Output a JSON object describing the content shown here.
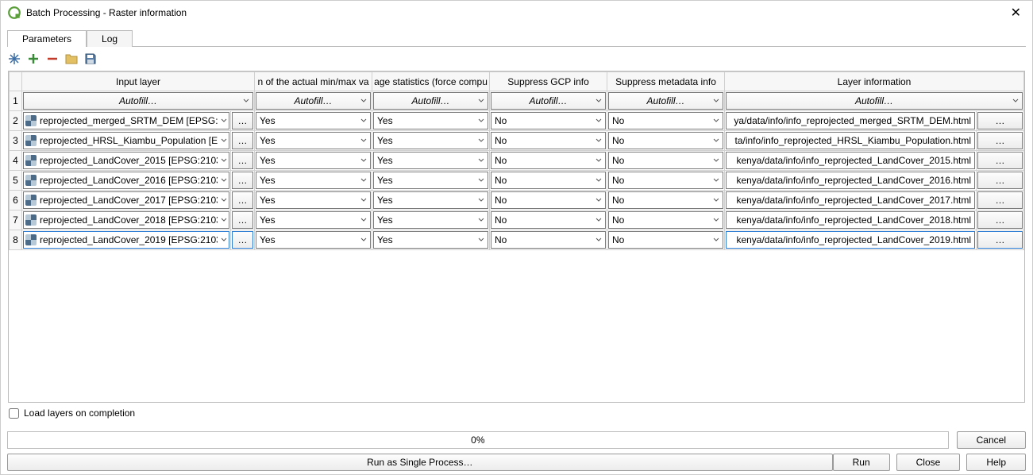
{
  "window": {
    "title": "Batch Processing - Raster information"
  },
  "tabs": {
    "parameters": "Parameters",
    "log": "Log"
  },
  "headers": {
    "input": "Input layer",
    "minmax": "n of the actual min/max va",
    "stats": "age statistics (force compu",
    "gcp": "Suppress GCP info",
    "meta": "Suppress metadata info",
    "info": "Layer information"
  },
  "autofill": "Autofill…",
  "more": "…",
  "rows": [
    {
      "n": "2",
      "input": "reprojected_merged_SRTM_DEM [EPSG:2",
      "minmax": "Yes",
      "stats": "Yes",
      "gcp": "No",
      "meta": "No",
      "info": "ya/data/info/info_reprojected_merged_SRTM_DEM.html"
    },
    {
      "n": "3",
      "input": "reprojected_HRSL_Kiambu_Population [E",
      "minmax": "Yes",
      "stats": "Yes",
      "gcp": "No",
      "meta": "No",
      "info": "ta/info/info_reprojected_HRSL_Kiambu_Population.html"
    },
    {
      "n": "4",
      "input": "reprojected_LandCover_2015 [EPSG:2103",
      "minmax": "Yes",
      "stats": "Yes",
      "gcp": "No",
      "meta": "No",
      "info": "kenya/data/info/info_reprojected_LandCover_2015.html"
    },
    {
      "n": "5",
      "input": "reprojected_LandCover_2016 [EPSG:2103",
      "minmax": "Yes",
      "stats": "Yes",
      "gcp": "No",
      "meta": "No",
      "info": "kenya/data/info/info_reprojected_LandCover_2016.html"
    },
    {
      "n": "6",
      "input": "reprojected_LandCover_2017 [EPSG:2103",
      "minmax": "Yes",
      "stats": "Yes",
      "gcp": "No",
      "meta": "No",
      "info": "kenya/data/info/info_reprojected_LandCover_2017.html"
    },
    {
      "n": "7",
      "input": "reprojected_LandCover_2018 [EPSG:2103",
      "minmax": "Yes",
      "stats": "Yes",
      "gcp": "No",
      "meta": "No",
      "info": "kenya/data/info/info_reprojected_LandCover_2018.html"
    },
    {
      "n": "8",
      "input": "reprojected_LandCover_2019 [EPSG:2103",
      "minmax": "Yes",
      "stats": "Yes",
      "gcp": "No",
      "meta": "No",
      "info": "kenya/data/info/info_reprojected_LandCover_2019.html"
    }
  ],
  "checkbox": {
    "label": "Load layers on completion"
  },
  "progress": {
    "text": "0%"
  },
  "buttons": {
    "cancel": "Cancel",
    "run_single": "Run as Single Process…",
    "run": "Run",
    "close": "Close",
    "help": "Help"
  }
}
